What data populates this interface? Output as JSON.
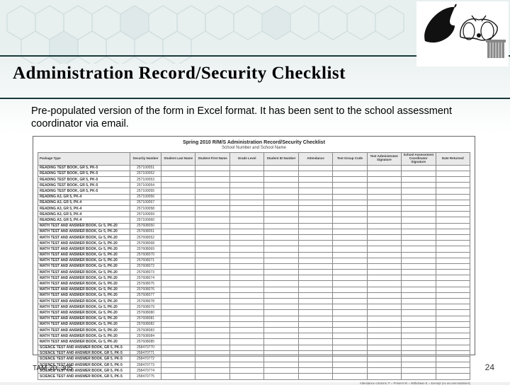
{
  "title": "Administration Record/Security Checklist",
  "description": "Pre-populated version of the form in Excel format.  It has been sent to the school assessment coordinator via email.",
  "form": {
    "heading": "Spring 2010 R/M/S Administration Record/Security Checklist",
    "subheading": "School Number and School Name",
    "columns": [
      "Package Type",
      "Security Number",
      "Student Last Name",
      "Student First Name",
      "Grade Level",
      "Student ID Number",
      "Attendance",
      "Test Group Code",
      "Test Administrator Signature",
      "School Assessment Coordinator Signature",
      "Date Returned"
    ],
    "rows": [
      {
        "pkg": "READING TEST BOOK, GR 5, PK-5",
        "sec": "257100051"
      },
      {
        "pkg": "READING TEST BOOK, GR 5, PK-5",
        "sec": "257100052"
      },
      {
        "pkg": "READING TEST BOOK, GR 5, PK-5",
        "sec": "257100053"
      },
      {
        "pkg": "READING TEST BOOK, GR 5, PK-5",
        "sec": "257100054"
      },
      {
        "pkg": "READING TEST BOOK, GR 5, PK-5",
        "sec": "257100055"
      },
      {
        "pkg": "READING A3, GR 5, PK-4",
        "sec": "257100056"
      },
      {
        "pkg": "READING A3, GR 5, PK-4",
        "sec": "257100057"
      },
      {
        "pkg": "READING A3, GR 5, PK-4",
        "sec": "257100058"
      },
      {
        "pkg": "READING A3, GR 5, PK-4",
        "sec": "257100059"
      },
      {
        "pkg": "READING A3, GR 5, PK-4",
        "sec": "257100060"
      },
      {
        "pkg": "MATH TEST AND ANSWER BOOK, Gr 5, PK-20",
        "sec": "257608050"
      },
      {
        "pkg": "MATH TEST AND ANSWER BOOK, Gr 5, PK-20",
        "sec": "257608051"
      },
      {
        "pkg": "MATH TEST AND ANSWER BOOK, Gr 5, PK-20",
        "sec": "257608052"
      },
      {
        "pkg": "MATH TEST AND ANSWER BOOK, Gr 5, PK-20",
        "sec": "257608068"
      },
      {
        "pkg": "MATH TEST AND ANSWER BOOK, Gr 5, PK-20",
        "sec": "257608069"
      },
      {
        "pkg": "MATH TEST AND ANSWER BOOK, Gr 5, PK-20",
        "sec": "257608070"
      },
      {
        "pkg": "MATH TEST AND ANSWER BOOK, Gr 5, PK-20",
        "sec": "257608071"
      },
      {
        "pkg": "MATH TEST AND ANSWER BOOK, Gr 5, PK-20",
        "sec": "257608072"
      },
      {
        "pkg": "MATH TEST AND ANSWER BOOK, Gr 5, PK-20",
        "sec": "257608073"
      },
      {
        "pkg": "MATH TEST AND ANSWER BOOK, Gr 5, PK-20",
        "sec": "257608074"
      },
      {
        "pkg": "MATH TEST AND ANSWER BOOK, Gr 5, PK-20",
        "sec": "257608075"
      },
      {
        "pkg": "MATH TEST AND ANSWER BOOK, Gr 5, PK-20",
        "sec": "257608076"
      },
      {
        "pkg": "MATH TEST AND ANSWER BOOK, Gr 5, PK-20",
        "sec": "257608077"
      },
      {
        "pkg": "MATH TEST AND ANSWER BOOK, Gr 5, PK-20",
        "sec": "257608078"
      },
      {
        "pkg": "MATH TEST AND ANSWER BOOK, Gr 5, PK-20",
        "sec": "257608079"
      },
      {
        "pkg": "MATH TEST AND ANSWER BOOK, Gr 5, PK-20",
        "sec": "257608080"
      },
      {
        "pkg": "MATH TEST AND ANSWER BOOK, Gr 5, PK-20",
        "sec": "257608081"
      },
      {
        "pkg": "MATH TEST AND ANSWER BOOK, Gr 5, PK-20",
        "sec": "257608082"
      },
      {
        "pkg": "MATH TEST AND ANSWER BOOK, Gr 5, PK-20",
        "sec": "257608083"
      },
      {
        "pkg": "MATH TEST AND ANSWER BOOK, Gr 5, PK-20",
        "sec": "257608084"
      },
      {
        "pkg": "MATH TEST AND ANSWER BOOK, Gr 5, PK-20",
        "sec": "257608085"
      },
      {
        "pkg": "SCIENCE TEST AND ANSWER BOOK, GR 5, PK-5",
        "sec": "258470770"
      },
      {
        "pkg": "SCIENCE TEST AND ANSWER BOOK, GR 5, PK-5",
        "sec": "258470771"
      },
      {
        "pkg": "SCIENCE TEST AND ANSWER BOOK, GR 5, PK-5",
        "sec": "258470772"
      },
      {
        "pkg": "SCIENCE TEST AND ANSWER BOOK, GR 5, PK-5",
        "sec": "258470773"
      },
      {
        "pkg": "SCIENCE TEST AND ANSWER BOOK, GR 5, PK-5",
        "sec": "258470774"
      },
      {
        "pkg": "SCIENCE TEST AND ANSWER BOOK, GR 5, PK-5",
        "sec": "258470775"
      }
    ],
    "legend": "Attendance columns:   P = Present   W = Withdrawn   E = Exempt (no accommodations)"
  },
  "footer": {
    "left": "TAM 20; 305",
    "right": "24"
  }
}
